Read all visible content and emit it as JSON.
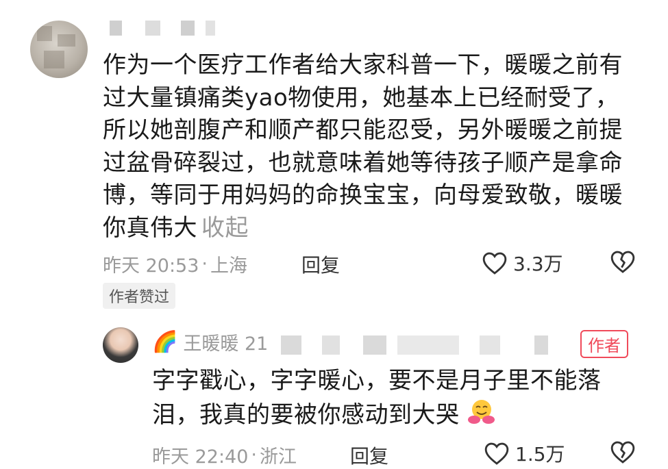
{
  "comment": {
    "text": "作为一个医疗工作者给大家科普一下，暖暖之前有过大量镇痛类yao物使用，她基本上已经耐受了，所以她剖腹产和顺产都只能忍受，另外暖暖之前提过盆骨碎裂过，也就意味着她等待孩子顺产是拿命博，等同于用妈妈的命换宝宝，向母爱致敬，暖暖你真伟大",
    "collapse_label": "收起",
    "time": "昨天 20:53",
    "location": "上海",
    "reply_label": "回复",
    "like_count": "3.3万",
    "author_liked_badge": "作者赞过"
  },
  "reply": {
    "name": "王暖暖 21",
    "author_badge": "作者",
    "text": "字字戳心，字字暖心，要不是月子里不能落泪，我真的要被你感动到大哭",
    "time": "昨天 22:40",
    "location": "浙江",
    "reply_label": "回复",
    "like_count": "1.5万"
  },
  "icons": {
    "like": "heart-outline-icon",
    "dislike": "broken-heart-icon",
    "rainbow": "rainbow-emoji",
    "hug": "hugging-face-emoji"
  },
  "colors": {
    "meta_gray": "#9a9a9a",
    "author_red": "#f04a5a"
  }
}
